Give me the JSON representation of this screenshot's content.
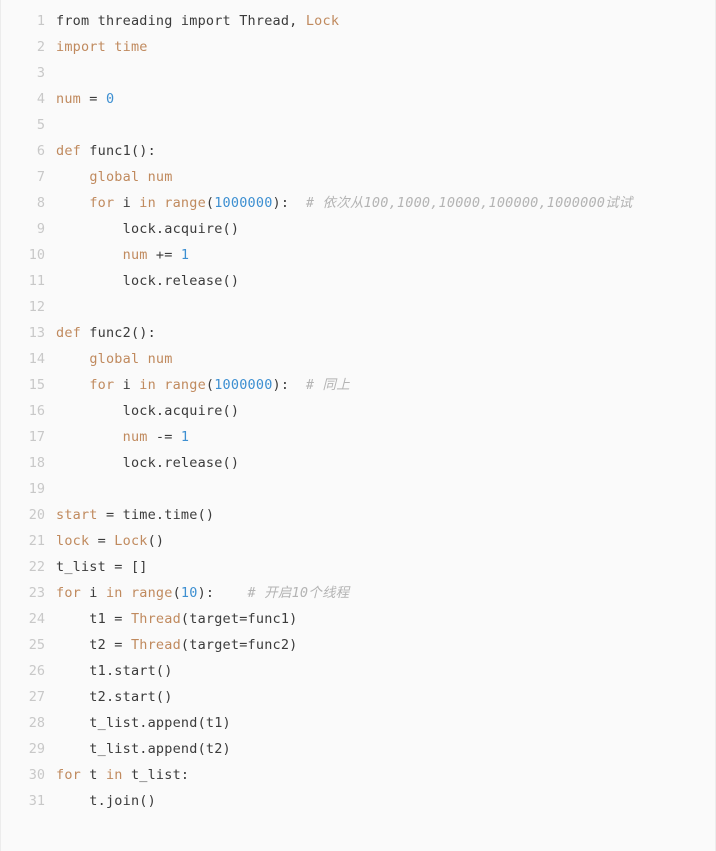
{
  "editor": {
    "language": "python",
    "background_color": "#fafafa",
    "border_color": "#ececec",
    "gutter_color": "#c8c8c8",
    "colors": {
      "keyword": "#c08a5e",
      "identifier": "#c08a5e",
      "number": "#3d8fd1",
      "text": "#3b3b3b",
      "comment": "#b4b4b4"
    },
    "total_lines": 31
  },
  "lines": [
    {
      "num": "1",
      "tokens": [
        {
          "t": "from threading import Thread, ",
          "c": "txt"
        },
        {
          "t": "Lock",
          "c": "cls"
        }
      ]
    },
    {
      "num": "2",
      "tokens": [
        {
          "t": "import time",
          "c": "kw"
        }
      ]
    },
    {
      "num": "3",
      "tokens": []
    },
    {
      "num": "4",
      "tokens": [
        {
          "t": "num",
          "c": "name"
        },
        {
          "t": " = ",
          "c": "txt"
        },
        {
          "t": "0",
          "c": "num"
        }
      ]
    },
    {
      "num": "5",
      "tokens": []
    },
    {
      "num": "6",
      "tokens": [
        {
          "t": "def",
          "c": "kw"
        },
        {
          "t": " func1():",
          "c": "txt"
        }
      ]
    },
    {
      "num": "7",
      "tokens": [
        {
          "t": "    ",
          "c": "txt"
        },
        {
          "t": "global num",
          "c": "kw"
        }
      ]
    },
    {
      "num": "8",
      "tokens": [
        {
          "t": "    ",
          "c": "txt"
        },
        {
          "t": "for",
          "c": "kw"
        },
        {
          "t": " i ",
          "c": "txt"
        },
        {
          "t": "in",
          "c": "kw"
        },
        {
          "t": " ",
          "c": "txt"
        },
        {
          "t": "range",
          "c": "name"
        },
        {
          "t": "(",
          "c": "txt"
        },
        {
          "t": "1000000",
          "c": "num"
        },
        {
          "t": "):  ",
          "c": "txt"
        },
        {
          "t": "# 依次从100,1000,10000,100000,1000000试试",
          "c": "cmt"
        }
      ]
    },
    {
      "num": "9",
      "tokens": [
        {
          "t": "        lock.acquire()",
          "c": "txt"
        }
      ]
    },
    {
      "num": "10",
      "tokens": [
        {
          "t": "        ",
          "c": "txt"
        },
        {
          "t": "num",
          "c": "name"
        },
        {
          "t": " += ",
          "c": "txt"
        },
        {
          "t": "1",
          "c": "num"
        }
      ]
    },
    {
      "num": "11",
      "tokens": [
        {
          "t": "        lock.release()",
          "c": "txt"
        }
      ]
    },
    {
      "num": "12",
      "tokens": []
    },
    {
      "num": "13",
      "tokens": [
        {
          "t": "def",
          "c": "kw"
        },
        {
          "t": " func2():",
          "c": "txt"
        }
      ]
    },
    {
      "num": "14",
      "tokens": [
        {
          "t": "    ",
          "c": "txt"
        },
        {
          "t": "global num",
          "c": "kw"
        }
      ]
    },
    {
      "num": "15",
      "tokens": [
        {
          "t": "    ",
          "c": "txt"
        },
        {
          "t": "for",
          "c": "kw"
        },
        {
          "t": " i ",
          "c": "txt"
        },
        {
          "t": "in",
          "c": "kw"
        },
        {
          "t": " ",
          "c": "txt"
        },
        {
          "t": "range",
          "c": "name"
        },
        {
          "t": "(",
          "c": "txt"
        },
        {
          "t": "1000000",
          "c": "num"
        },
        {
          "t": "):  ",
          "c": "txt"
        },
        {
          "t": "# 同上",
          "c": "cmt"
        }
      ]
    },
    {
      "num": "16",
      "tokens": [
        {
          "t": "        lock.acquire()",
          "c": "txt"
        }
      ]
    },
    {
      "num": "17",
      "tokens": [
        {
          "t": "        ",
          "c": "txt"
        },
        {
          "t": "num",
          "c": "name"
        },
        {
          "t": " -= ",
          "c": "txt"
        },
        {
          "t": "1",
          "c": "num"
        }
      ]
    },
    {
      "num": "18",
      "tokens": [
        {
          "t": "        lock.release()",
          "c": "txt"
        }
      ]
    },
    {
      "num": "19",
      "tokens": []
    },
    {
      "num": "20",
      "tokens": [
        {
          "t": "start",
          "c": "name"
        },
        {
          "t": " = time.time()",
          "c": "txt"
        }
      ]
    },
    {
      "num": "21",
      "tokens": [
        {
          "t": "lock",
          "c": "name"
        },
        {
          "t": " = ",
          "c": "txt"
        },
        {
          "t": "Lock",
          "c": "cls"
        },
        {
          "t": "()",
          "c": "txt"
        }
      ]
    },
    {
      "num": "22",
      "tokens": [
        {
          "t": "t_list = []",
          "c": "txt"
        }
      ]
    },
    {
      "num": "23",
      "tokens": [
        {
          "t": "for",
          "c": "kw"
        },
        {
          "t": " i ",
          "c": "txt"
        },
        {
          "t": "in",
          "c": "kw"
        },
        {
          "t": " ",
          "c": "txt"
        },
        {
          "t": "range",
          "c": "name"
        },
        {
          "t": "(",
          "c": "txt"
        },
        {
          "t": "10",
          "c": "num"
        },
        {
          "t": "):    ",
          "c": "txt"
        },
        {
          "t": "# 开启10个线程",
          "c": "cmt"
        }
      ]
    },
    {
      "num": "24",
      "tokens": [
        {
          "t": "    t1 = ",
          "c": "txt"
        },
        {
          "t": "Thread",
          "c": "cls"
        },
        {
          "t": "(target=func1)",
          "c": "txt"
        }
      ]
    },
    {
      "num": "25",
      "tokens": [
        {
          "t": "    t2 = ",
          "c": "txt"
        },
        {
          "t": "Thread",
          "c": "cls"
        },
        {
          "t": "(target=func2)",
          "c": "txt"
        }
      ]
    },
    {
      "num": "26",
      "tokens": [
        {
          "t": "    t1.start()",
          "c": "txt"
        }
      ]
    },
    {
      "num": "27",
      "tokens": [
        {
          "t": "    t2.start()",
          "c": "txt"
        }
      ]
    },
    {
      "num": "28",
      "tokens": [
        {
          "t": "    t_list.append(t1)",
          "c": "txt"
        }
      ]
    },
    {
      "num": "29",
      "tokens": [
        {
          "t": "    t_list.append(t2)",
          "c": "txt"
        }
      ]
    },
    {
      "num": "30",
      "tokens": [
        {
          "t": "for",
          "c": "kw"
        },
        {
          "t": " t ",
          "c": "txt"
        },
        {
          "t": "in",
          "c": "kw"
        },
        {
          "t": " t_list:",
          "c": "txt"
        }
      ]
    },
    {
      "num": "31",
      "tokens": [
        {
          "t": "    t.join()",
          "c": "txt"
        }
      ]
    }
  ]
}
